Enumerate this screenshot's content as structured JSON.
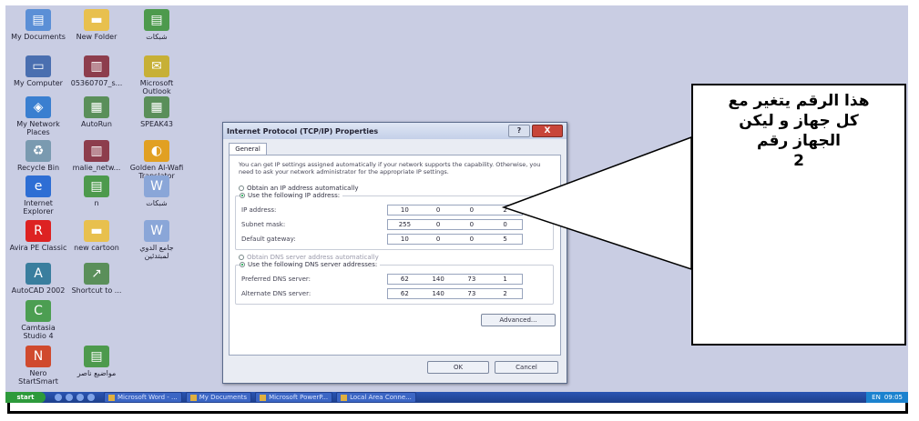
{
  "desktop": {
    "icons": [
      {
        "label": "My Documents",
        "icon": "documents-icon"
      },
      {
        "label": "New Folder",
        "icon": "folder-icon"
      },
      {
        "label": "شبكات",
        "icon": "excel-file-icon"
      },
      {
        "label": "My Computer",
        "icon": "computer-icon"
      },
      {
        "label": "05360707_s...",
        "icon": "rar-archive-icon"
      },
      {
        "label": "Microsoft Outlook",
        "icon": "outlook-icon"
      },
      {
        "label": "My Network Places",
        "icon": "network-places-icon"
      },
      {
        "label": "AutoRun",
        "icon": "autorun-icon"
      },
      {
        "label": "SPEAK43",
        "icon": "speak-icon"
      },
      {
        "label": "Recycle Bin",
        "icon": "recycle-bin-icon"
      },
      {
        "label": "malie_netw...",
        "icon": "rar-archive-icon"
      },
      {
        "label": "Golden Al-Wafi Translator",
        "icon": "golden-translator-icon"
      },
      {
        "label": "Internet Explorer",
        "icon": "internet-explorer-icon"
      },
      {
        "label": "n",
        "icon": "excel-file-icon"
      },
      {
        "label": "شبكات",
        "icon": "word-file-icon"
      },
      {
        "label": "Avira PE Classic",
        "icon": "avira-icon"
      },
      {
        "label": "new cartoon",
        "icon": "folder-icon"
      },
      {
        "label": "جامع الدوي لمبتدئين",
        "icon": "word-file-icon"
      },
      {
        "label": "AutoCAD 2002",
        "icon": "autocad-icon"
      },
      {
        "label": "Shortcut to ...",
        "icon": "shortcut-icon"
      },
      {
        "label": "Camtasia Studio 4",
        "icon": "camtasia-icon"
      },
      {
        "label": "Nero StartSmart",
        "icon": "nero-icon"
      },
      {
        "label": "مواضيع ناصر",
        "icon": "excel-file-icon"
      }
    ]
  },
  "dialog": {
    "title": "Internet Protocol (TCP/IP) Properties",
    "help_label": "?",
    "close_label": "X",
    "tab_general": "General",
    "intro": "You can get IP settings assigned automatically if your network supports the capability. Otherwise, you need to ask your network administrator for the appropriate IP settings.",
    "radio_auto_ip": "Obtain an IP address automatically",
    "radio_manual_ip": "Use the following IP address:",
    "ip_label": "IP address:",
    "ip_value": [
      "10",
      "0",
      "0",
      "2"
    ],
    "subnet_label": "Subnet mask:",
    "subnet_value": [
      "255",
      "0",
      "0",
      "0"
    ],
    "gateway_label": "Default gateway:",
    "gateway_value": [
      "10",
      "0",
      "0",
      "5"
    ],
    "radio_auto_dns": "Obtain DNS server address automatically",
    "radio_manual_dns": "Use the following DNS server addresses:",
    "preferred_dns_label": "Preferred DNS server:",
    "preferred_dns_value": [
      "62",
      "140",
      "73",
      "1"
    ],
    "alternate_dns_label": "Alternate DNS server:",
    "alternate_dns_value": [
      "62",
      "140",
      "73",
      "2"
    ],
    "advanced_label": "Advanced...",
    "ok_label": "OK",
    "cancel_label": "Cancel"
  },
  "taskbar": {
    "start_label": "start",
    "tasks": [
      "Microsoft Word - ...",
      "My Documents",
      "Microsoft PowerP...",
      "Local Area Conne..."
    ],
    "lang": "EN",
    "clock": "09:05"
  },
  "callout": {
    "lines": [
      "هذا الرقم يتغير مع",
      "كل جهاز و ليكن",
      "الجهاز رقم",
      "2"
    ]
  }
}
